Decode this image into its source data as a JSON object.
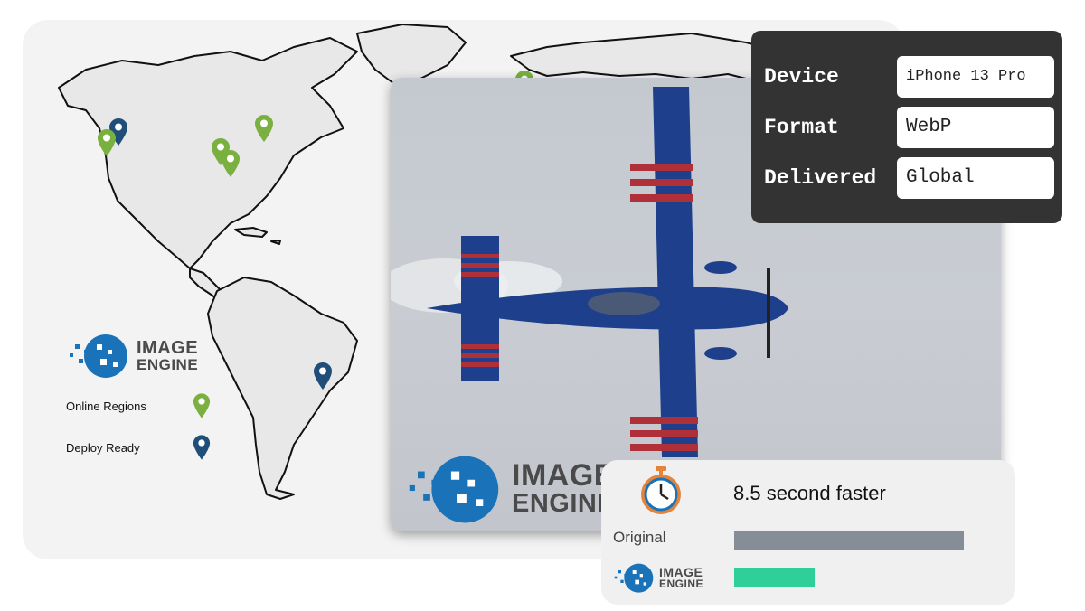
{
  "brand": {
    "name_line1": "IMAGE",
    "name_line2": "ENGINE",
    "primary_color": "#1a73b8",
    "text_color": "#4a4a4a"
  },
  "map": {
    "legend": {
      "items": [
        {
          "label": "Online Regions",
          "icon": "map-pin-icon",
          "color": "#7ab040"
        },
        {
          "label": "Deploy Ready",
          "icon": "map-pin-icon",
          "color": "#1f4e79"
        }
      ]
    },
    "pins": [
      {
        "type": "online",
        "color": "#7ab040"
      },
      {
        "type": "deploy",
        "color": "#1f4e79"
      },
      {
        "type": "online",
        "color": "#7ab040"
      },
      {
        "type": "online",
        "color": "#7ab040"
      },
      {
        "type": "online",
        "color": "#7ab040"
      },
      {
        "type": "deploy",
        "color": "#1f4e79"
      },
      {
        "type": "online",
        "color": "#7ab040"
      }
    ]
  },
  "delivery_info": {
    "rows": [
      {
        "label": "Device",
        "value": "iPhone 13 Pro"
      },
      {
        "label": "Format",
        "value": "WebP"
      },
      {
        "label": "Delivered",
        "value": "Global"
      }
    ]
  },
  "performance": {
    "title": "8.5 second faster",
    "icon": "stopwatch-icon",
    "bars": [
      {
        "label": "Original",
        "relative_length": 1.0,
        "color": "#858d96"
      },
      {
        "label": "IMAGE ENGINE",
        "relative_length": 0.35,
        "color": "#2ecf98"
      }
    ]
  }
}
